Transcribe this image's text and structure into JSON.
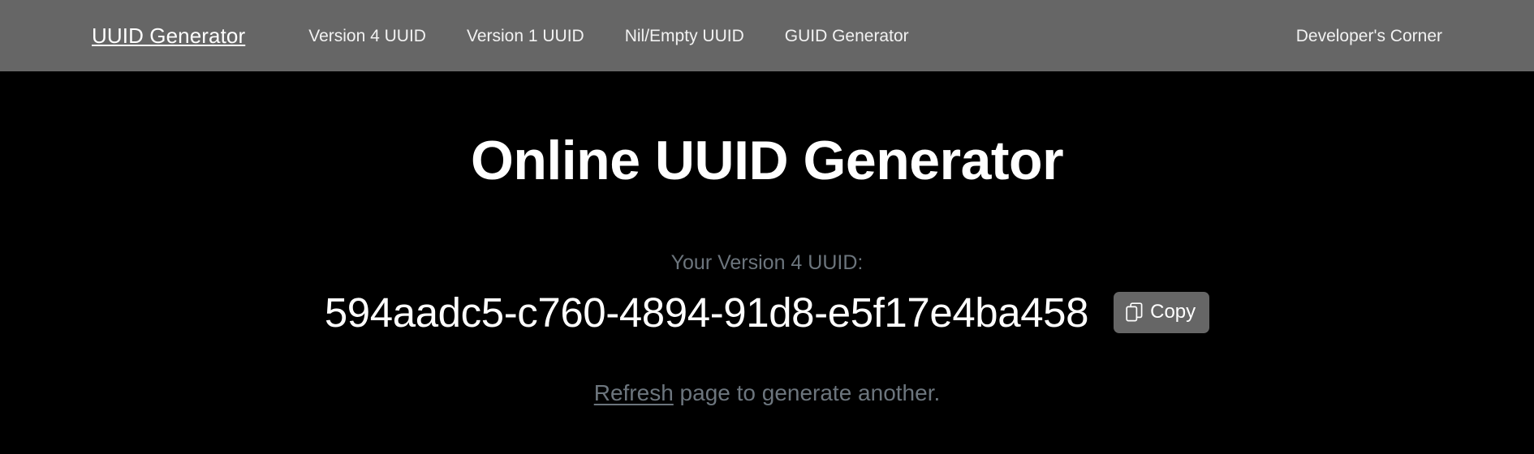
{
  "colors": {
    "navbar_bg": "#666666",
    "page_bg": "#000000",
    "brand_text": "#ffffff",
    "nav_link": "#f2f2f2",
    "heading": "#ffffff",
    "muted_text": "#6c757d",
    "uuid_text": "#ffffff",
    "button_bg": "#666666",
    "button_text": "#ffffff"
  },
  "navbar": {
    "brand": "UUID Generator",
    "links": [
      {
        "label": "Version 4 UUID"
      },
      {
        "label": "Version 1 UUID"
      },
      {
        "label": "Nil/Empty UUID"
      },
      {
        "label": "GUID Generator"
      }
    ],
    "right_link": {
      "label": "Developer's Corner"
    }
  },
  "main": {
    "title": "Online UUID Generator",
    "uuid_label": "Your Version 4 UUID:",
    "uuid_value": "594aadc5-c760-4894-91d8-e5f17e4ba458",
    "copy_button": {
      "label": "Copy",
      "icon": "copy-icon"
    },
    "refresh": {
      "link_text": "Refresh",
      "rest_text": " page to generate another."
    }
  }
}
